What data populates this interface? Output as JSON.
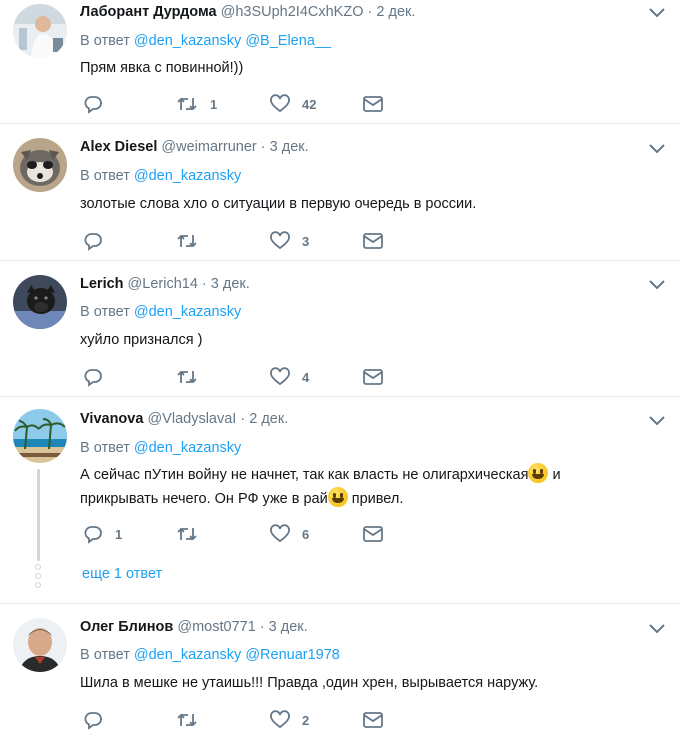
{
  "tweets": [
    {
      "name": "Лаборант Дурдома",
      "handle": "@h3SUph2I4CxhKZO",
      "date": "2 дек.",
      "reply_prefix": "В ответ",
      "mentions": "@den_kazansky @B_Elena__",
      "text": "Прям явка с повинной!))",
      "replies": "",
      "retweets": "1",
      "likes": "42"
    },
    {
      "name": "Alex Diesel",
      "handle": "@weimarruner",
      "date": "3 дек.",
      "reply_prefix": "В ответ",
      "mentions": "@den_kazansky",
      "text": "золотые слова хло о ситуации в первую очередь в россии.",
      "replies": "",
      "retweets": "",
      "likes": "3"
    },
    {
      "name": "Lerich",
      "handle": "@Lerich14",
      "date": "3 дек.",
      "reply_prefix": "В ответ",
      "mentions": "@den_kazansky",
      "text": "хуйло признался )",
      "replies": "",
      "retweets": "",
      "likes": "4"
    },
    {
      "name": "Vivanova",
      "handle": "@VladyslavaI",
      "date": "2 дек.",
      "reply_prefix": "В ответ",
      "mentions": "@den_kazansky",
      "text_line1": "А сейчас пУтин войну не начнет, так как власть  не олигархическая",
      "text_line1_end": " и",
      "text_line2": "прикрывать нечего. Он РФ уже в рай",
      "text_line2_end": " привел.",
      "replies": "1",
      "retweets": "",
      "likes": "6",
      "more_replies": "еще 1 ответ"
    },
    {
      "name": "Олег Блинов",
      "handle": "@most0771",
      "date": "3 дек.",
      "reply_prefix": "В ответ",
      "mentions": "@den_kazansky @Renuar1978",
      "text": "Шила в мешке не утаишь!!! Правда ,один хрен, вырывается наружу.",
      "replies": "",
      "retweets": "",
      "likes": "2"
    }
  ],
  "colors": {
    "link": "#1da1f2",
    "muted": "#657786",
    "text": "#14171a",
    "divider": "#e6ecf0"
  }
}
